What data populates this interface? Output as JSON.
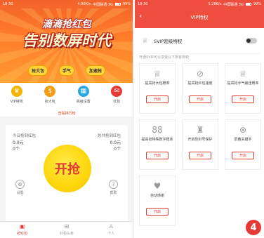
{
  "left": {
    "status": {
      "time": "18:30",
      "net": "4.90K/s",
      "carrier": "中国联通 3G",
      "battery": "99%"
    },
    "banner": {
      "line1": "滴滴抢红包",
      "line2": "告别数屏时代",
      "pills": [
        "抢大包",
        "手气",
        "加速抢"
      ]
    },
    "features": [
      {
        "label": "VIP特权",
        "icon": "crown-icon",
        "glyph": "♛",
        "color": "#f5b400"
      },
      {
        "label": "抢大包",
        "icon": "money-bag-icon",
        "glyph": "$",
        "color": "#f39c12"
      },
      {
        "label": "高级设置",
        "icon": "grid-icon",
        "glyph": "▦",
        "color": "#29a8e0"
      },
      {
        "label": "红包",
        "icon": "redpacket-icon",
        "glyph": "✉",
        "color": "#e53935"
      }
    ],
    "rank_link": "查看排行榜",
    "today_label": "今日抢到红包",
    "today_amount": "0.0元",
    "today_count": "0个",
    "total_label": "总共抢到红包",
    "total_amount": "0.0元",
    "total_count": "0个",
    "grab_button": "开抢",
    "settings_label": "设置",
    "help_label": "帮助",
    "tabs": [
      "抢红包",
      "红包头条",
      "个人"
    ]
  },
  "right": {
    "status": {
      "time": "18:30",
      "net": "5.28K/s",
      "carrier": "中国联通 3G",
      "battery": "99%"
    },
    "title": "VIP特权",
    "svip_label": "SVIP超级特权",
    "svip_hint": "开通SVIP可以享受以下所有特权",
    "button_label": "开启",
    "cards": [
      {
        "title": "提高抢大包概率",
        "icon": "crown-outline-icon",
        "glyph": "♕"
      },
      {
        "title": "提高抢红包速度",
        "icon": "image-slash-icon",
        "glyph": "⊘"
      },
      {
        "title": "提高抢手气最佳概率",
        "icon": "crown-outline-icon",
        "glyph": "♕"
      },
      {
        "title": "提高抢特殊数字概率",
        "icon": "digits-icon",
        "glyph": "88"
      },
      {
        "title": "开启防封号保护",
        "icon": "user-shield-icon",
        "glyph": "♜"
      },
      {
        "title": "屏蔽关键字",
        "icon": "block-keyword-icon",
        "glyph": "⊗"
      },
      {
        "title": "自动感谢",
        "icon": "heart-icon",
        "glyph": "♥"
      }
    ],
    "badge": "4"
  }
}
